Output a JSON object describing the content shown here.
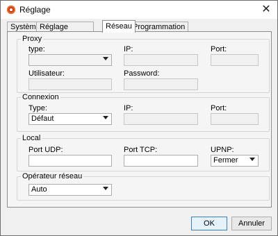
{
  "window": {
    "title": "Réglage",
    "close_glyph": "✕"
  },
  "tabs": [
    {
      "label": "Système"
    },
    {
      "label": "Réglage enregistrement"
    },
    {
      "label": "Réseau"
    },
    {
      "label": "Programmation alerte"
    }
  ],
  "active_tab": "Réseau",
  "proxy": {
    "group_title": "Proxy",
    "type_label": "type:",
    "type_value": "",
    "ip_label": "IP:",
    "port_label": "Port:",
    "user_label": "Utilisateur:",
    "password_label": "Password:"
  },
  "connexion": {
    "group_title": "Connexion",
    "type_label": "Type:",
    "type_value": "Défaut",
    "ip_label": "IP:",
    "port_label": "Port:"
  },
  "local": {
    "group_title": "Local",
    "udp_label": "Port UDP:",
    "tcp_label": "Port TCP:",
    "upnp_label": "UPNP:",
    "upnp_value": "Fermer"
  },
  "operator": {
    "group_title": "Opérateur réseau",
    "value": "Auto"
  },
  "buttons": {
    "ok": "OK",
    "cancel": "Annuler"
  },
  "icons": {
    "app": "app-logo-icon",
    "close": "close-icon",
    "dropdown": "chevron-down-icon"
  }
}
